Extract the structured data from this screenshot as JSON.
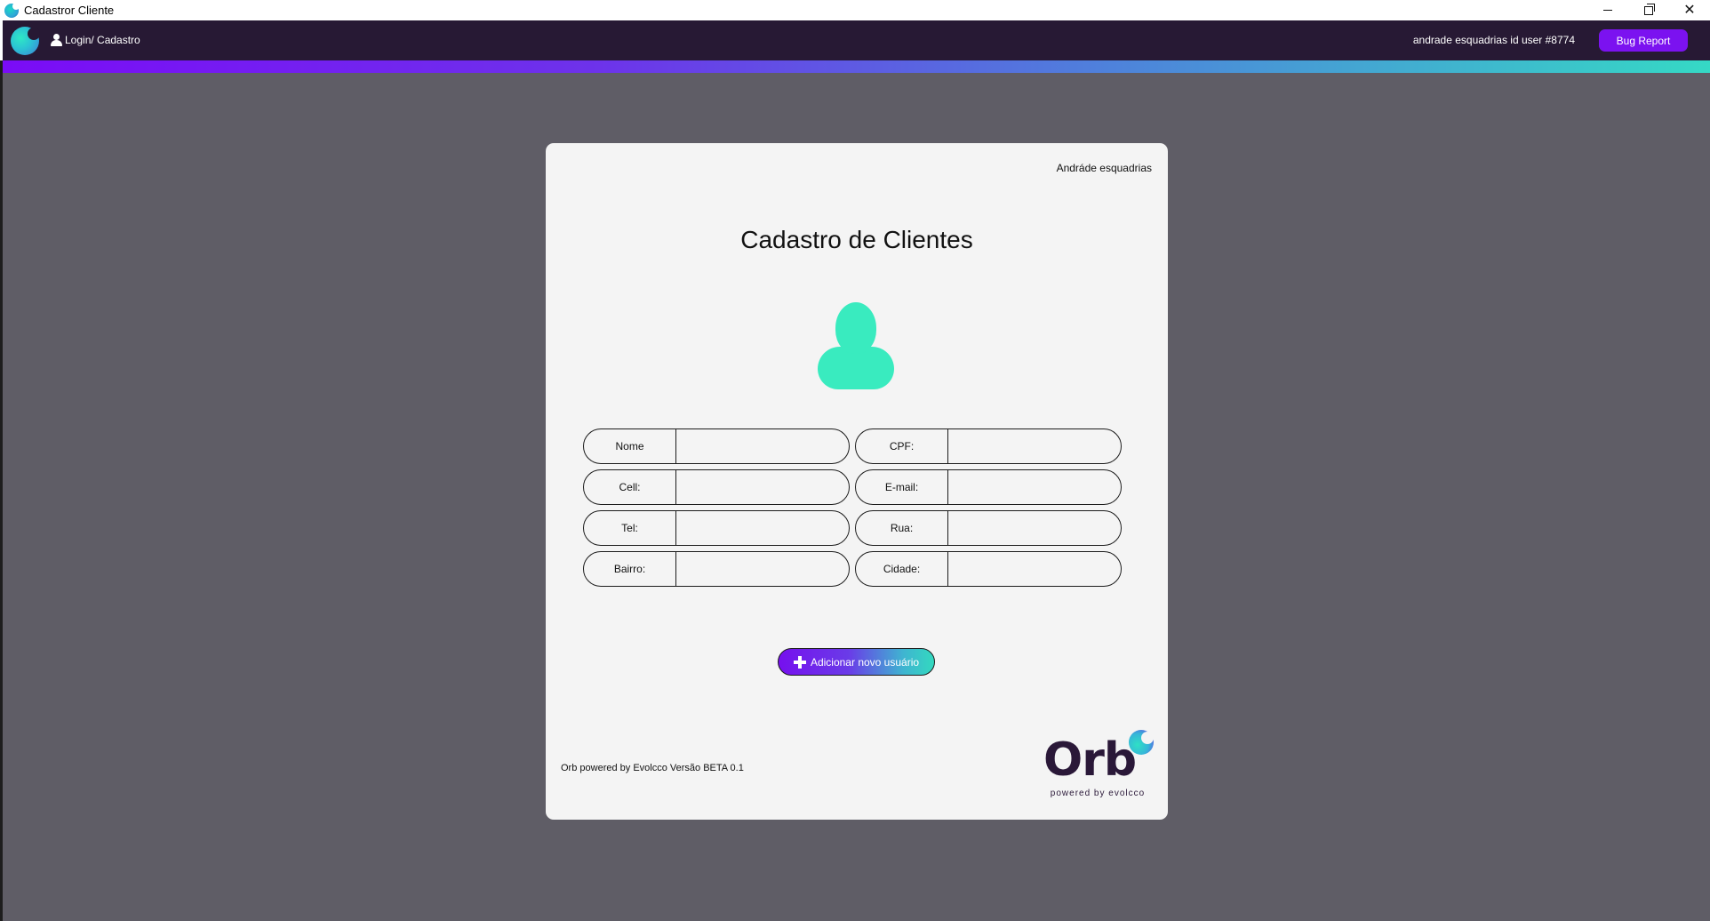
{
  "window": {
    "title": "Cadastror Cliente",
    "controls": [
      "minimize",
      "restore",
      "close"
    ]
  },
  "appbar": {
    "nav_login": "Login/ Cadastro",
    "user_info": "andrade esquadrias id user  #8774",
    "bug_report": "Bug Report"
  },
  "card": {
    "company": "Andráde esquadrias",
    "heading": "Cadastro de Clientes",
    "fields": [
      {
        "label": "Nome",
        "value": ""
      },
      {
        "label": "CPF:",
        "value": ""
      },
      {
        "label": "Cell:",
        "value": ""
      },
      {
        "label": "E-mail:",
        "value": ""
      },
      {
        "label": "Tel:",
        "value": ""
      },
      {
        "label": "Rua:",
        "value": ""
      },
      {
        "label": "Bairro:",
        "value": ""
      },
      {
        "label": "Cidade:",
        "value": ""
      }
    ],
    "add_button": "Adicionar novo usuário",
    "footer": "Orb powered by Evolcco Versão BETA 0.1"
  },
  "logo": {
    "word": "Orb",
    "tagline": "powered by evolcco"
  },
  "colors": {
    "appbar_bg": "#271934",
    "accent_purple": "#7b12f0",
    "accent_teal": "#39ebbf",
    "workspace_bg": "#5f5d66",
    "card_bg": "#f4f4f4"
  },
  "icons": {
    "app": "orb-moon-icon",
    "user": "user-icon",
    "avatar": "user-silhouette-icon",
    "add": "plus-icon"
  }
}
